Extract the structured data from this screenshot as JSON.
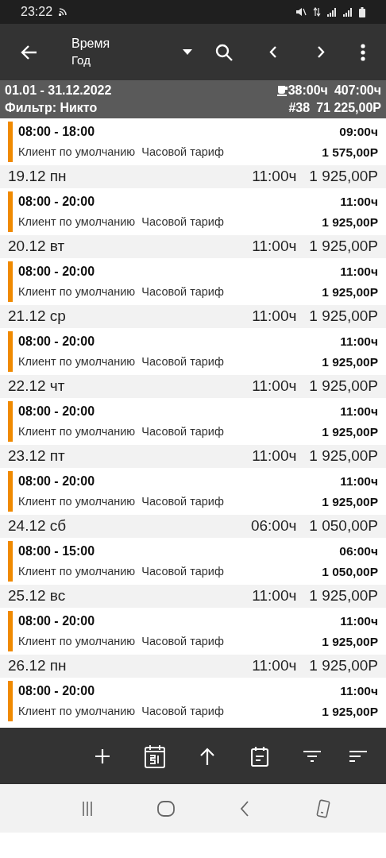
{
  "status_bar": {
    "time": "23:22"
  },
  "app_bar": {
    "title": "Время",
    "subtitle": "Год"
  },
  "summary": {
    "period": "01.01 - 31.12.2022",
    "break_hours": "38:00ч",
    "total_hours": "407:00ч",
    "filter": "Фильтр: Никто",
    "count": "#38",
    "total_amount": "71 225,00Р"
  },
  "days": [
    {
      "entries": [
        {
          "time": "08:00 - 18:00",
          "client": "Клиент по умолчанию",
          "tariff": "Часовой тариф",
          "hours": "09:00ч",
          "amount": "1 575,00Р"
        }
      ]
    },
    {
      "date": "19.12 пн",
      "hours": "11:00ч",
      "amount": "1 925,00Р",
      "entries": [
        {
          "time": "08:00 - 20:00",
          "client": "Клиент по умолчанию",
          "tariff": "Часовой тариф",
          "hours": "11:00ч",
          "amount": "1 925,00Р"
        }
      ]
    },
    {
      "date": "20.12 вт",
      "hours": "11:00ч",
      "amount": "1 925,00Р",
      "entries": [
        {
          "time": "08:00 - 20:00",
          "client": "Клиент по умолчанию",
          "tariff": "Часовой тариф",
          "hours": "11:00ч",
          "amount": "1 925,00Р"
        }
      ]
    },
    {
      "date": "21.12 ср",
      "hours": "11:00ч",
      "amount": "1 925,00Р",
      "entries": [
        {
          "time": "08:00 - 20:00",
          "client": "Клиент по умолчанию",
          "tariff": "Часовой тариф",
          "hours": "11:00ч",
          "amount": "1 925,00Р"
        }
      ]
    },
    {
      "date": "22.12 чт",
      "hours": "11:00ч",
      "amount": "1 925,00Р",
      "entries": [
        {
          "time": "08:00 - 20:00",
          "client": "Клиент по умолчанию",
          "tariff": "Часовой тариф",
          "hours": "11:00ч",
          "amount": "1 925,00Р"
        }
      ]
    },
    {
      "date": "23.12 пт",
      "hours": "11:00ч",
      "amount": "1 925,00Р",
      "entries": [
        {
          "time": "08:00 - 20:00",
          "client": "Клиент по умолчанию",
          "tariff": "Часовой тариф",
          "hours": "11:00ч",
          "amount": "1 925,00Р"
        }
      ]
    },
    {
      "date": "24.12 сб",
      "hours": "06:00ч",
      "amount": "1 050,00Р",
      "entries": [
        {
          "time": "08:00 - 15:00",
          "client": "Клиент по умолчанию",
          "tariff": "Часовой тариф",
          "hours": "06:00ч",
          "amount": "1 050,00Р"
        }
      ]
    },
    {
      "date": "25.12 вс",
      "hours": "11:00ч",
      "amount": "1 925,00Р",
      "entries": [
        {
          "time": "08:00 - 20:00",
          "client": "Клиент по умолчанию",
          "tariff": "Часовой тариф",
          "hours": "11:00ч",
          "amount": "1 925,00Р"
        }
      ]
    },
    {
      "date": "26.12 пн",
      "hours": "11:00ч",
      "amount": "1 925,00Р",
      "entries": [
        {
          "time": "08:00 - 20:00",
          "client": "Клиент по умолчанию",
          "tariff": "Часовой тариф",
          "hours": "11:00ч",
          "amount": "1 925,00Р"
        }
      ]
    }
  ]
}
